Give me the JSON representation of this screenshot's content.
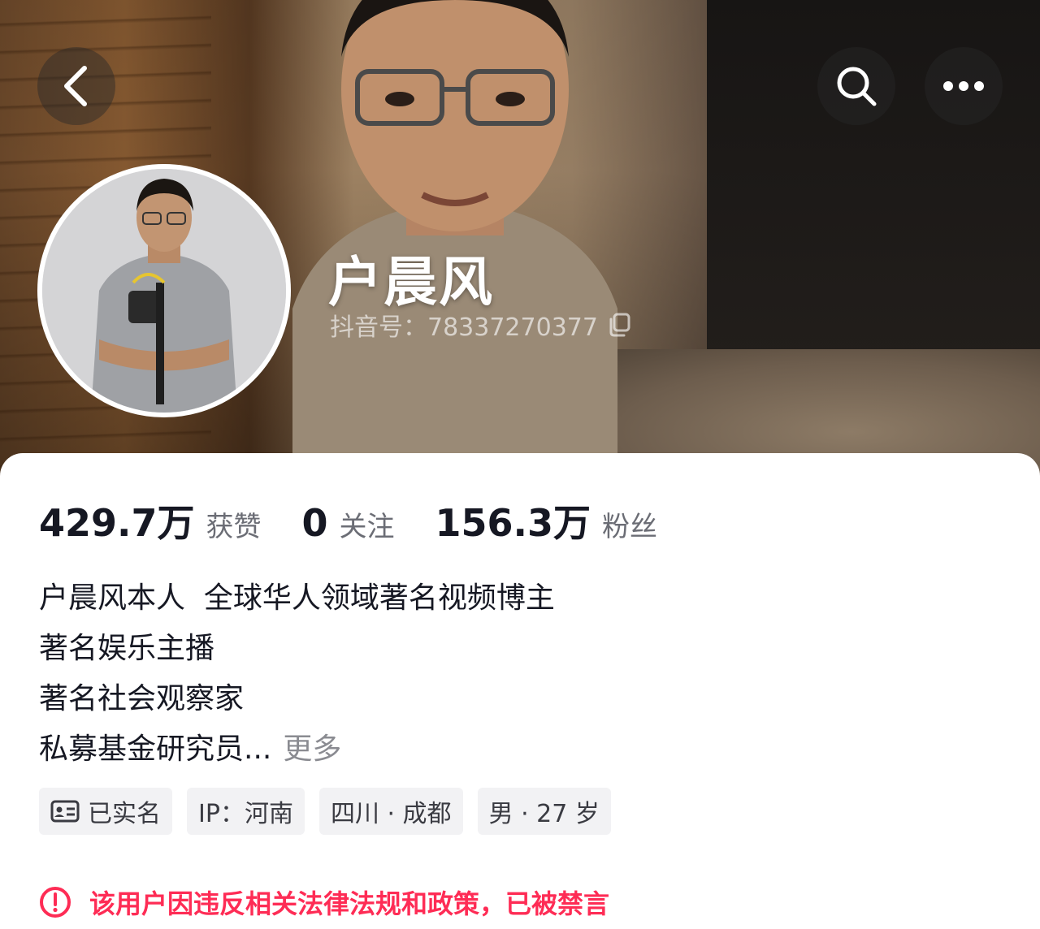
{
  "profile": {
    "nickname": "户晨风",
    "douyin_id_label": "抖音号：",
    "douyin_id": "78337270377"
  },
  "top_bar": {
    "back_icon": "chevron-left-icon",
    "search_icon": "search-icon",
    "more_icon": "more-horizontal-icon"
  },
  "stats": [
    {
      "value": "429.7万",
      "label": "获赞"
    },
    {
      "value": "0",
      "label": "关注"
    },
    {
      "value": "156.3万",
      "label": "粉丝"
    }
  ],
  "bio": {
    "lines": [
      "户晨风本人  全球华人领域著名视频博主",
      "著名娱乐主播",
      "著名社会观察家",
      "私募基金研究员..."
    ],
    "more_label": "更多"
  },
  "tags": [
    {
      "label": "已实名",
      "icon": "id-card-icon"
    },
    {
      "label": "IP：河南"
    },
    {
      "label": "四川 · 成都"
    },
    {
      "label": "男 · 27 岁"
    }
  ],
  "notice": {
    "icon": "alert-circle-icon",
    "text": "该用户因违反相关法律法规和政策，已被禁言",
    "color": "#fe2c55"
  }
}
